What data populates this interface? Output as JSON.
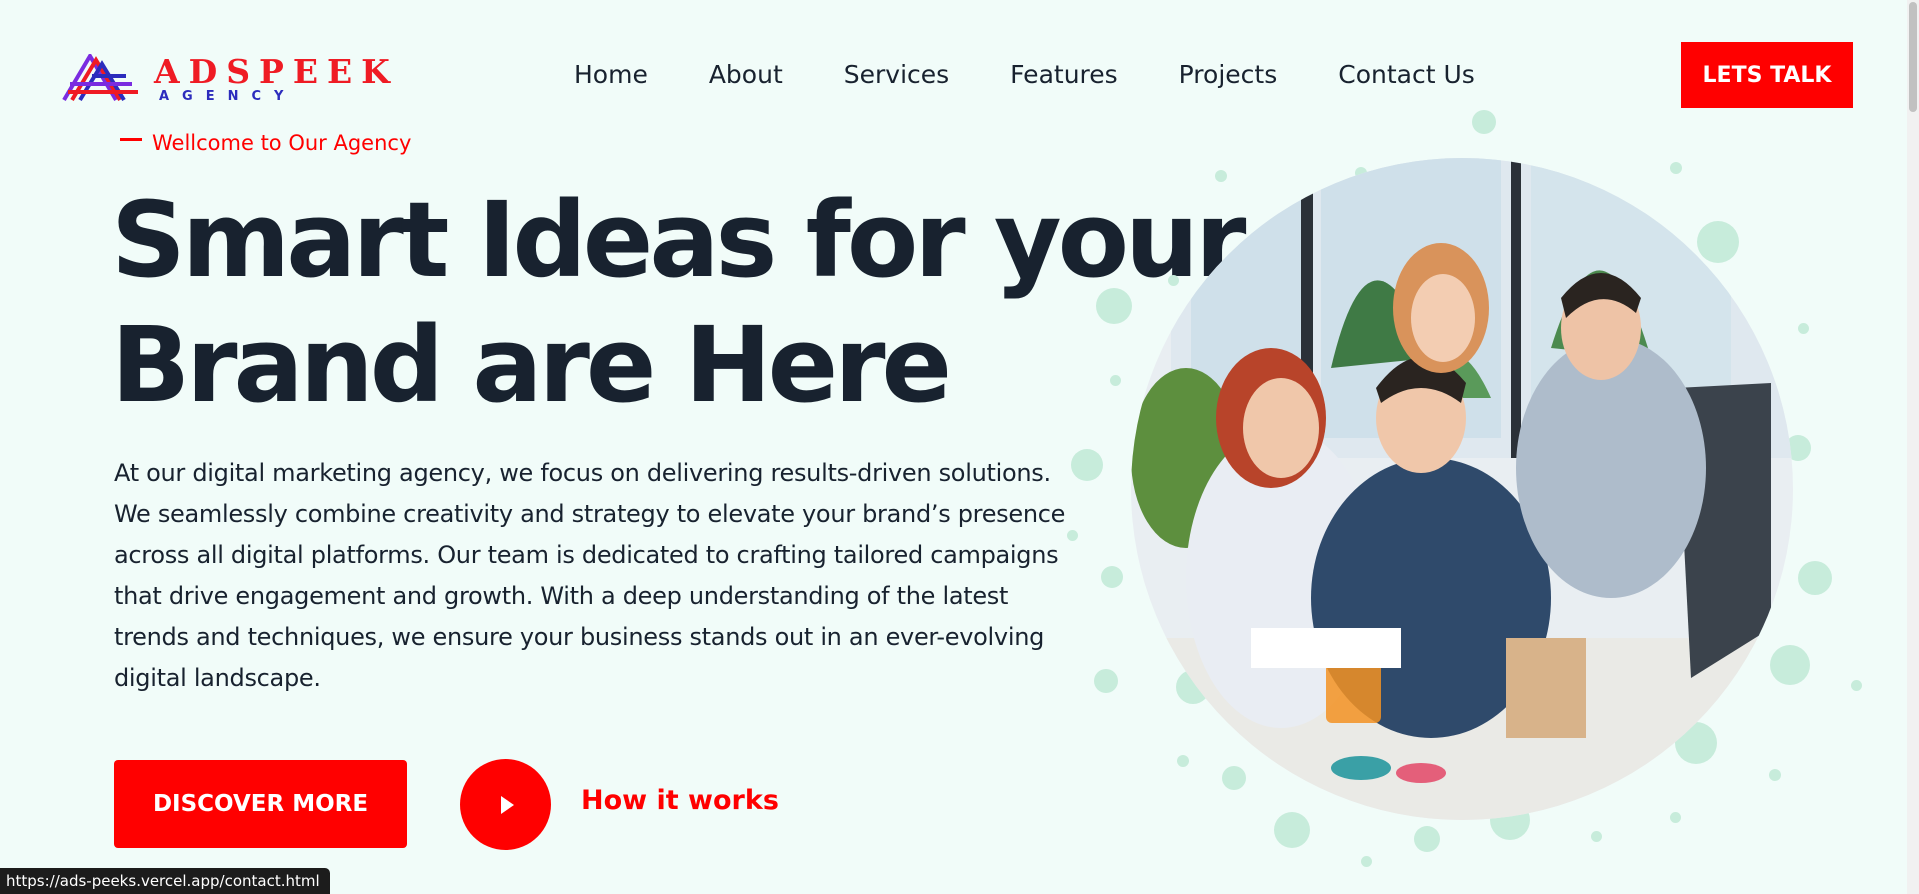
{
  "logo": {
    "word": "ADSPEEK",
    "sub": "AGENCY"
  },
  "nav": {
    "items": [
      "Home",
      "About",
      "Services",
      "Features",
      "Projects",
      "Contact Us"
    ]
  },
  "header": {
    "cta_label": "LETS TALK"
  },
  "hero": {
    "eyebrow": "Wellcome to Our Agency",
    "title_line1": "Smart Ideas for your",
    "title_line2": "Brand are Here",
    "paragraph": "At our digital marketing agency, we focus on delivering results-driven solutions. We seamlessly combine creativity and strategy to elevate your brand’s presence across all digital platforms. Our team is dedicated to crafting tailored campaigns that drive engagement and growth. With a deep understanding of the latest trends and techniques, we ensure your business stands out in an ever-evolving digital landscape.",
    "discover_label": "DISCOVER MORE",
    "how_label": "How it works"
  },
  "status_bar": {
    "url": "https://ads-peeks.vercel.app/contact.html"
  },
  "colors": {
    "accent": "#ff0000",
    "background": "#f1fcf9",
    "text": "#18222f",
    "dots": "#c7ecdb",
    "logo_blue": "#2c2cbd"
  },
  "icons": [
    "logo-mark-icon",
    "play-icon"
  ]
}
